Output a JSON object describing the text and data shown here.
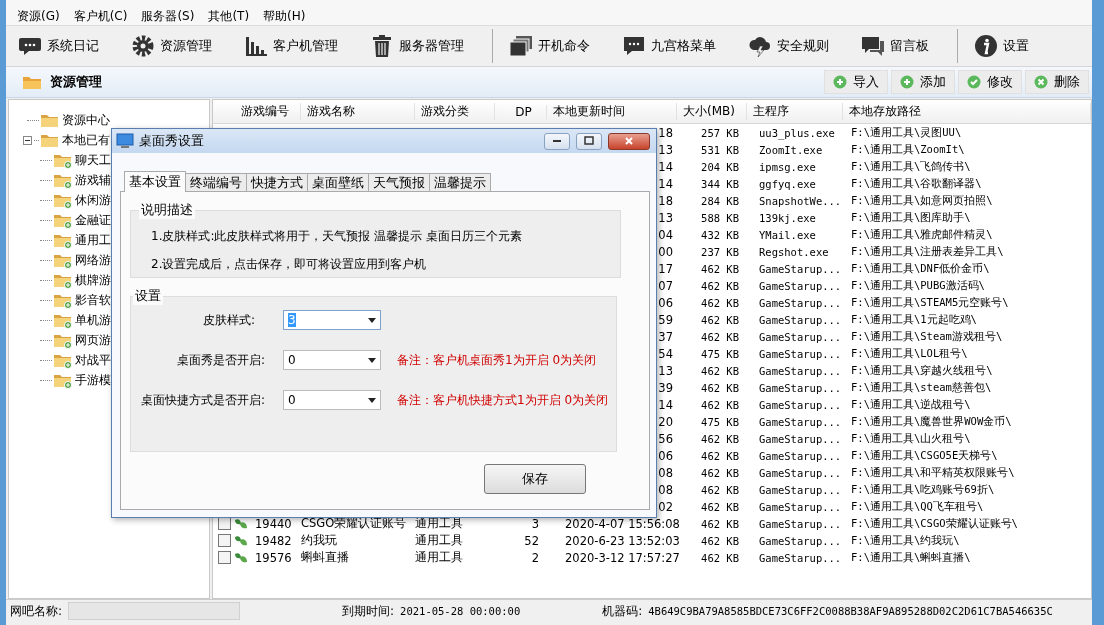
{
  "menu": [
    "资源(G)",
    "客户机(C)",
    "服务器(S)",
    "其他(T)",
    "帮助(H)"
  ],
  "toolbar": {
    "groups": [
      {
        "buttons": [
          "系统日记",
          "资源管理",
          "客户机管理",
          "服务器管理"
        ]
      },
      {
        "buttons": [
          "开机命令",
          "九宫格菜单",
          "安全规则",
          "留言板"
        ]
      },
      {
        "buttons": [
          "设置"
        ]
      }
    ]
  },
  "section": {
    "title": "资源管理",
    "actions": [
      "导入",
      "添加",
      "修改",
      "删除"
    ]
  },
  "tree": [
    {
      "label": "资源中心"
    },
    {
      "label": "本地已有",
      "expanded": true,
      "children": [
        {
          "label": "聊天工"
        },
        {
          "label": "游戏辅"
        },
        {
          "label": "休闲游"
        },
        {
          "label": "金融证"
        },
        {
          "label": "通用工"
        },
        {
          "label": "网络游"
        },
        {
          "label": "棋牌游"
        },
        {
          "label": "影音软"
        },
        {
          "label": "单机游"
        },
        {
          "label": "网页游"
        },
        {
          "label": "对战平"
        },
        {
          "label": "手游模"
        }
      ]
    }
  ],
  "table": {
    "columns": [
      "游戏编号",
      "游戏名称",
      "游戏分类",
      "DP",
      "本地更新时间",
      "大小(MB)",
      "主程序",
      "本地存放路径"
    ],
    "rows": [
      {
        "update_time": "18",
        "size": "257 KB",
        "program": "uu3_plus.exe",
        "path": "F:\\通用工具\\灵图UU\\"
      },
      {
        "update_time": "13",
        "size": "531 KB",
        "program": "ZoomIt.exe",
        "path": "F:\\通用工具\\ZoomIt\\"
      },
      {
        "update_time": "14",
        "size": "204 KB",
        "program": "ipmsg.exe",
        "path": "F:\\通用工具\\飞鸽传书\\"
      },
      {
        "update_time": "14",
        "size": "344 KB",
        "program": "ggfyq.exe",
        "path": "F:\\通用工具\\谷歌翻译器\\"
      },
      {
        "update_time": "18",
        "size": "284 KB",
        "program": "SnapshotWe...",
        "path": "F:\\通用工具\\如意网页拍照\\"
      },
      {
        "update_time": "13",
        "size": "588 KB",
        "program": "139kj.exe",
        "path": "F:\\通用工具\\图库助手\\"
      },
      {
        "update_time": "04",
        "size": "432 KB",
        "program": "YMail.exe",
        "path": "F:\\通用工具\\雅虎邮件精灵\\"
      },
      {
        "update_time": "00",
        "size": "237 KB",
        "program": "Regshot.exe",
        "path": "F:\\通用工具\\注册表差异工具\\"
      },
      {
        "update_time": "17",
        "size": "462 KB",
        "program": "GameStarup...",
        "path": "F:\\通用工具\\DNF低价金币\\"
      },
      {
        "update_time": "07",
        "size": "462 KB",
        "program": "GameStarup...",
        "path": "F:\\通用工具\\PUBG激活码\\"
      },
      {
        "update_time": "06",
        "size": "462 KB",
        "program": "GameStarup...",
        "path": "F:\\通用工具\\STEAM5元空账号\\"
      },
      {
        "update_time": "59",
        "size": "462 KB",
        "program": "GameStarup...",
        "path": "F:\\通用工具\\1元起吃鸡\\"
      },
      {
        "update_time": "37",
        "size": "462 KB",
        "program": "GameStarup...",
        "path": "F:\\通用工具\\Steam游戏租号\\"
      },
      {
        "update_time": "54",
        "size": "475 KB",
        "program": "GameStarup...",
        "path": "F:\\通用工具\\LOL租号\\"
      },
      {
        "update_time": "13",
        "size": "462 KB",
        "program": "GameStarup...",
        "path": "F:\\通用工具\\穿越火线租号\\"
      },
      {
        "update_time": "39",
        "size": "462 KB",
        "program": "GameStarup...",
        "path": "F:\\通用工具\\steam慈善包\\"
      },
      {
        "update_time": "14",
        "size": "462 KB",
        "program": "GameStarup...",
        "path": "F:\\通用工具\\逆战租号\\"
      },
      {
        "update_time": "20",
        "size": "475 KB",
        "program": "GameStarup...",
        "path": "F:\\通用工具\\魔兽世界WOW金币\\"
      },
      {
        "update_time": "56",
        "size": "462 KB",
        "program": "GameStarup...",
        "path": "F:\\通用工具\\山火租号\\"
      },
      {
        "update_time": "06",
        "size": "462 KB",
        "program": "GameStarup...",
        "path": "F:\\通用工具\\CSGO5E天梯号\\"
      },
      {
        "update_time": "08",
        "size": "462 KB",
        "program": "GameStarup...",
        "path": "F:\\通用工具\\和平精英权限账号\\"
      },
      {
        "update_time": "08",
        "size": "462 KB",
        "program": "GameStarup...",
        "path": "F:\\通用工具\\吃鸡账号69折\\"
      },
      {
        "update_time": "02",
        "size": "462 KB",
        "program": "GameStarup...",
        "path": "F:\\通用工具\\QQ飞车租号\\"
      },
      {
        "checked": false,
        "id": "19440",
        "name": "CSGO荣耀认证账号",
        "category": "通用工具",
        "dp": "3",
        "update_time": "2020-4-07 15:56:08",
        "size": "462 KB",
        "program": "GameStarup...",
        "path": "F:\\通用工具\\CSGO荣耀认证账号\\"
      },
      {
        "checked": false,
        "id": "19482",
        "name": "约我玩",
        "category": "通用工具",
        "dp": "52",
        "update_time": "2020-6-23 13:52:03",
        "size": "462 KB",
        "program": "GameStarup...",
        "path": "F:\\通用工具\\约我玩\\"
      },
      {
        "checked": false,
        "id": "19576",
        "name": "蝌蚪直播",
        "category": "通用工具",
        "dp": "2",
        "update_time": "2020-3-12 17:57:27",
        "size": "462 KB",
        "program": "GameStarup...",
        "path": "F:\\通用工具\\蝌蚪直播\\"
      }
    ]
  },
  "status_bar": {
    "netbar_label": "网吧名称:",
    "expiry_label": "到期时间:",
    "expiry": "2021-05-28 00:00:00",
    "machine_label": "机器码:",
    "machine_code": "4B649C9BA79A8585BDCE73C6FF2C0088B38AF9A895288D02C2D61C7BA546635C"
  },
  "dialog": {
    "title": "桌面秀设置",
    "tabs": [
      {
        "label": "基本设置",
        "selected": true
      },
      {
        "label": "终端编号",
        "selected": false
      },
      {
        "label": "快捷方式",
        "selected": false
      },
      {
        "label": "桌面壁纸",
        "selected": false
      },
      {
        "label": "天气预报",
        "selected": false
      },
      {
        "label": "温馨提示",
        "selected": false
      }
    ],
    "description": {
      "title": "说明描述",
      "lines": [
        "1.皮肤样式:此皮肤样式将用于，天气预报 温馨提示 桌面日历三个元素",
        "2.设置完成后，点击保存，即可将设置应用到客户机"
      ]
    },
    "settings": {
      "title": "设置",
      "fields": [
        {
          "label": "皮肤样式:",
          "value": "3",
          "focused": true
        },
        {
          "label": "桌面秀是否开启:",
          "value": "0",
          "focused": false,
          "note": "备注：客户机桌面秀1为开启 0为关闭"
        },
        {
          "label": "桌面快捷方式是否开启:",
          "value": "0",
          "focused": false,
          "note": "备注：客户机快捷方式1为开启 0为关闭"
        }
      ]
    },
    "save_button": "保存"
  }
}
